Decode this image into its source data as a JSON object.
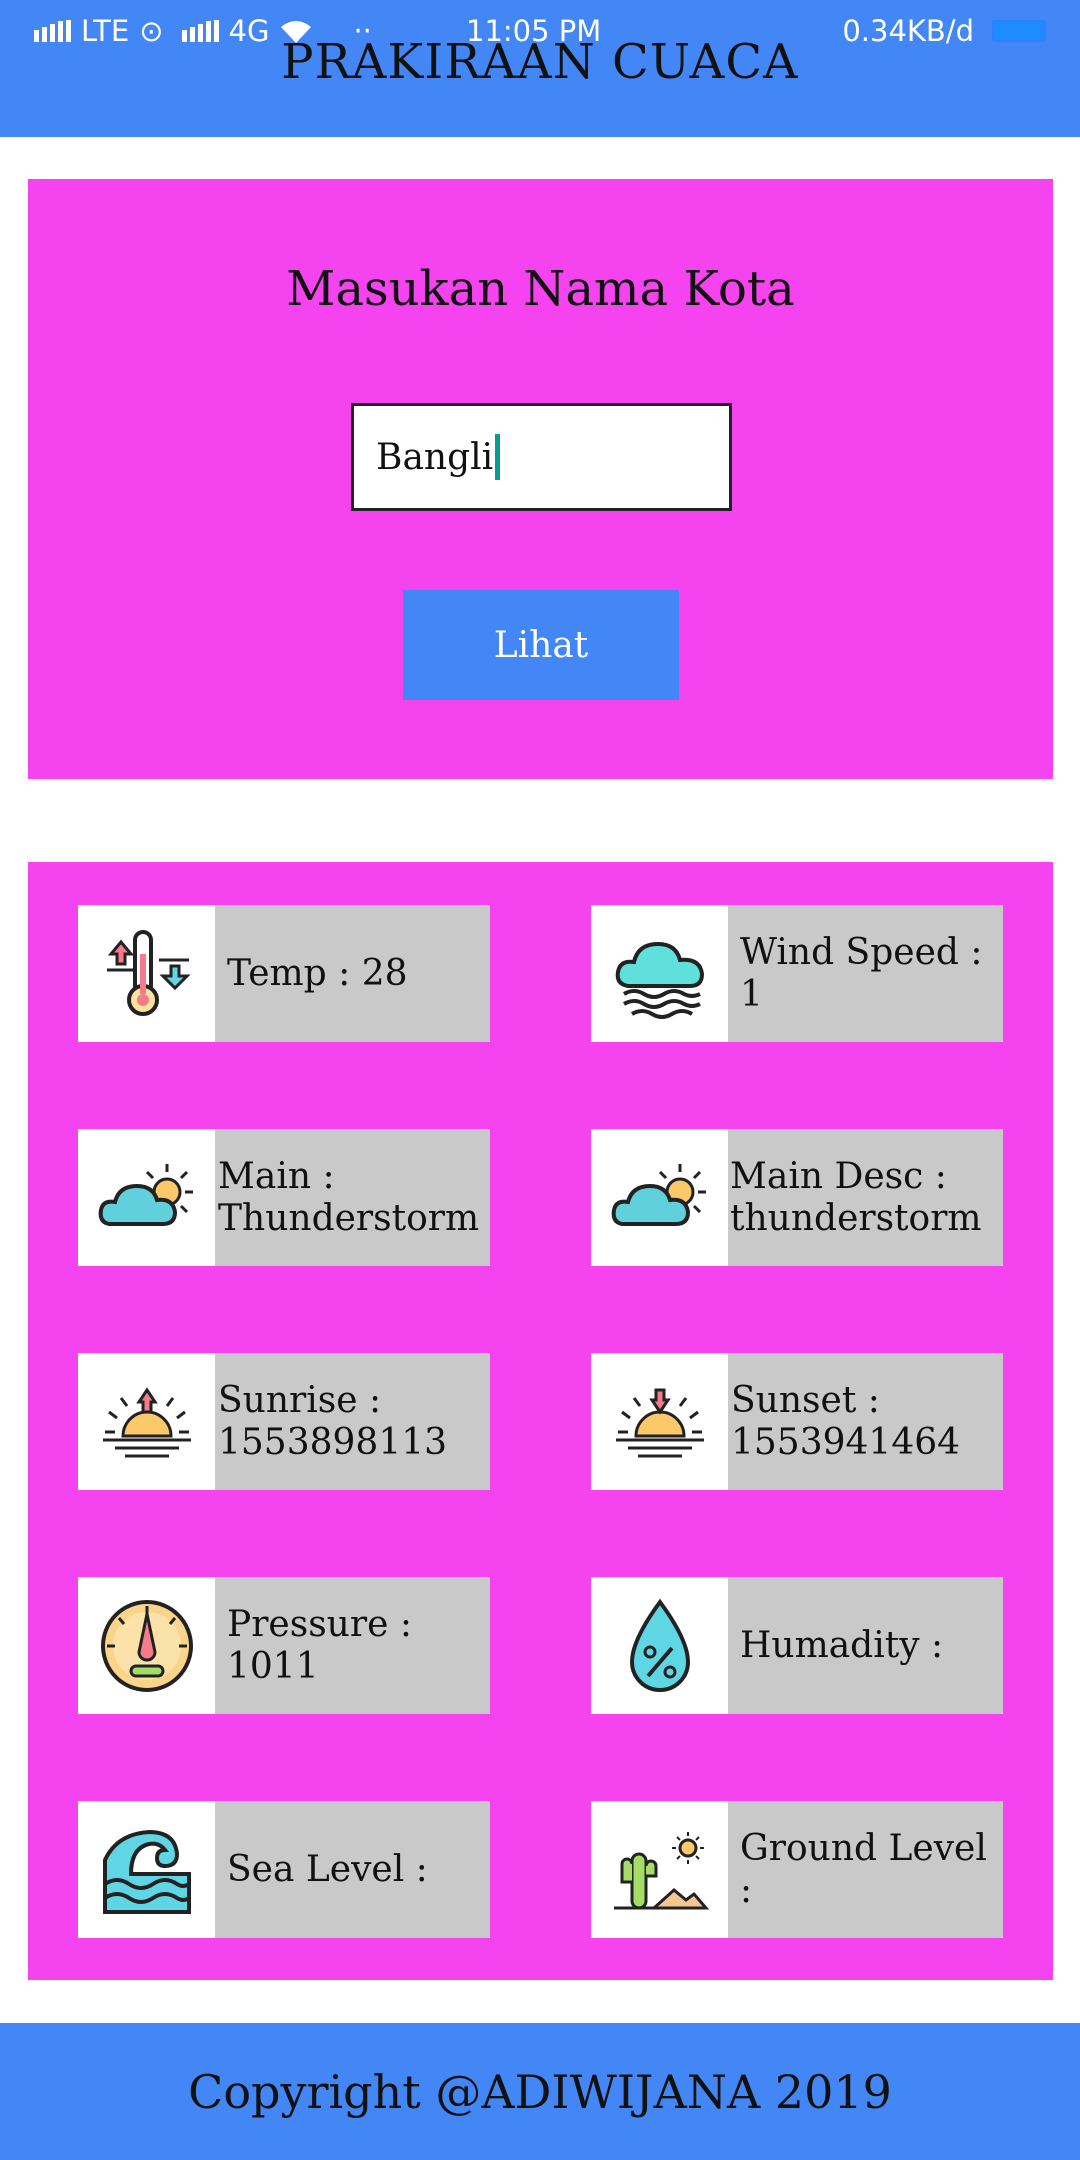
{
  "status_bar": {
    "carrier_left": "LTE",
    "network": "4G",
    "dots": "··",
    "time": "11:05 PM",
    "speed": "0.34KB/d"
  },
  "header": {
    "title": "PRAKIRAAN CUACA"
  },
  "search": {
    "heading": "Masukan Nama Kota",
    "input_value": "Bangli",
    "button_label": "Lihat"
  },
  "weather": {
    "temp": "Temp : 28",
    "wind": "Wind Speed : 1",
    "main": "Main :\nThunderstorm",
    "main_desc": "Main Desc :\nthunderstorm",
    "sunrise": "Sunrise :\n1553898113",
    "sunset": "Sunset :\n1553941464",
    "pressure": "Pressure : 1011",
    "humidity": "Humadity :",
    "sea_level": "Sea Level :",
    "ground_level": "Ground Level :"
  },
  "footer": {
    "text": "Copyright @ADIWIJANA 2019"
  },
  "colors": {
    "header": "#4287f5",
    "panel": "#f443ef",
    "label_bg": "#c9c9c9"
  }
}
